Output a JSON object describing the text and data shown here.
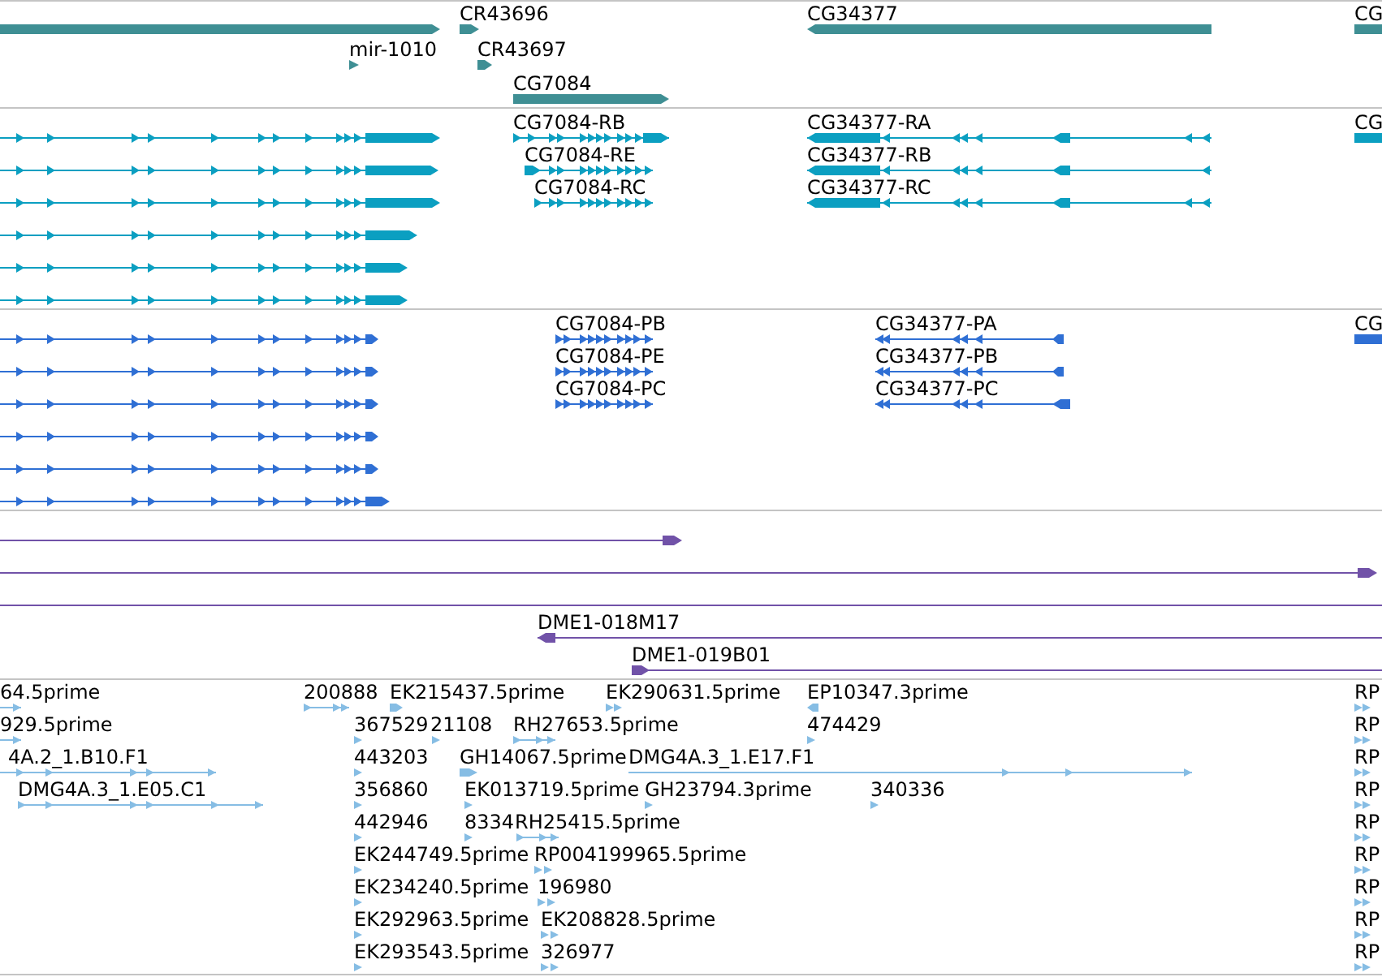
{
  "tracks": [
    {
      "kind": "gene",
      "features": [
        {
          "reverse": false
        },
        {
          "label": "CR43696",
          "reverse": false
        },
        {
          "label": "CG34377",
          "reverse": true
        },
        {
          "label": "CG"
        },
        {
          "label": "mir-1010",
          "reverse": false
        },
        {
          "label": "CR43697",
          "reverse": false
        },
        {
          "label": "CG7084",
          "reverse": false
        }
      ]
    },
    {
      "kind": "transcript",
      "features": [
        {
          "reverse": false
        },
        {
          "label": "CG7084-RB",
          "reverse": false
        },
        {
          "label": "CG34377-RA",
          "reverse": true
        },
        {
          "label": "CG"
        },
        {
          "reverse": false
        },
        {
          "label": "CG7084-RE",
          "reverse": false
        },
        {
          "label": "CG34377-RB",
          "reverse": true
        },
        {
          "reverse": false
        },
        {
          "label": "CG7084-RC",
          "reverse": false
        },
        {
          "label": "CG34377-RC",
          "reverse": true
        },
        {
          "reverse": false
        },
        {
          "reverse": false
        },
        {
          "reverse": false
        }
      ]
    },
    {
      "kind": "protein",
      "features": [
        {
          "reverse": false
        },
        {
          "label": "CG7084-PB",
          "reverse": false
        },
        {
          "label": "CG34377-PA",
          "reverse": true
        },
        {
          "label": "CG"
        },
        {
          "reverse": false
        },
        {
          "label": "CG7084-PE",
          "reverse": false
        },
        {
          "label": "CG34377-PB",
          "reverse": true
        },
        {
          "reverse": false
        },
        {
          "label": "CG7084-PC",
          "reverse": false
        },
        {
          "label": "CG34377-PC",
          "reverse": true
        },
        {
          "reverse": false
        },
        {
          "reverse": false
        },
        {
          "reverse": false
        }
      ]
    },
    {
      "kind": "clone",
      "features": [
        {
          "kind": "arrow",
          "reverse": false
        },
        {
          "kind": "arrow",
          "reverse": false
        },
        {
          "kind": "line"
        },
        {
          "kind": "arrow",
          "label": "DME1-018M17",
          "reverse": true
        },
        {
          "kind": "arrow",
          "label": "DME1-019B01",
          "reverse": false
        }
      ]
    },
    {
      "kind": "est",
      "features": [
        {
          "label": "64.5prime",
          "reverse": false
        },
        {
          "label": "200888",
          "reverse": false
        },
        {
          "label": "EK215437.5prime",
          "reverse": false
        },
        {
          "label": "EK290631.5prime",
          "reverse": false
        },
        {
          "label": "EP10347.3prime",
          "reverse": true
        },
        {
          "label": "RP",
          "reverse": false
        },
        {
          "label": "929.5prime",
          "reverse": false
        },
        {
          "label": "367529",
          "reverse": false
        },
        {
          "label": "21108",
          "reverse": false
        },
        {
          "label": "RH27653.5prime",
          "reverse": false
        },
        {
          "label": "474429",
          "reverse": false
        },
        {
          "label": "RP",
          "reverse": false
        },
        {
          "label": "4A.2_1.B10.F1",
          "reverse": false
        },
        {
          "label": "443203",
          "reverse": false
        },
        {
          "label": "GH14067.5prime",
          "reverse": false
        },
        {
          "label": "DMG4A.3_1.E17.F1",
          "reverse": false
        },
        {
          "label": "RP",
          "reverse": false
        },
        {
          "label": "DMG4A.3_1.E05.C1",
          "reverse": false
        },
        {
          "label": "356860",
          "reverse": false
        },
        {
          "label": "EK013719.5prime",
          "reverse": false
        },
        {
          "label": "GH23794.3prime",
          "reverse": false
        },
        {
          "label": "340336",
          "reverse": false
        },
        {
          "label": "RP",
          "reverse": false
        },
        {
          "label": "442946",
          "reverse": false
        },
        {
          "label": "8334",
          "reverse": false
        },
        {
          "label": "RH25415.5prime",
          "reverse": false
        },
        {
          "label": "RP",
          "reverse": false
        },
        {
          "label": "EK244749.5prime",
          "reverse": false
        },
        {
          "label": "RP004199965.5prime",
          "reverse": false
        },
        {
          "label": "RP",
          "reverse": false
        },
        {
          "label": "EK234240.5prime",
          "reverse": false
        },
        {
          "label": "196980",
          "reverse": false
        },
        {
          "label": "RP",
          "reverse": false
        },
        {
          "label": "EK292963.5prime",
          "reverse": false
        },
        {
          "label": "EK208828.5prime",
          "reverse": false
        },
        {
          "label": "RP",
          "reverse": false
        },
        {
          "label": "EK293543.5prime",
          "reverse": false
        },
        {
          "label": "326977",
          "reverse": false
        },
        {
          "label": "RP",
          "reverse": false
        }
      ]
    }
  ]
}
